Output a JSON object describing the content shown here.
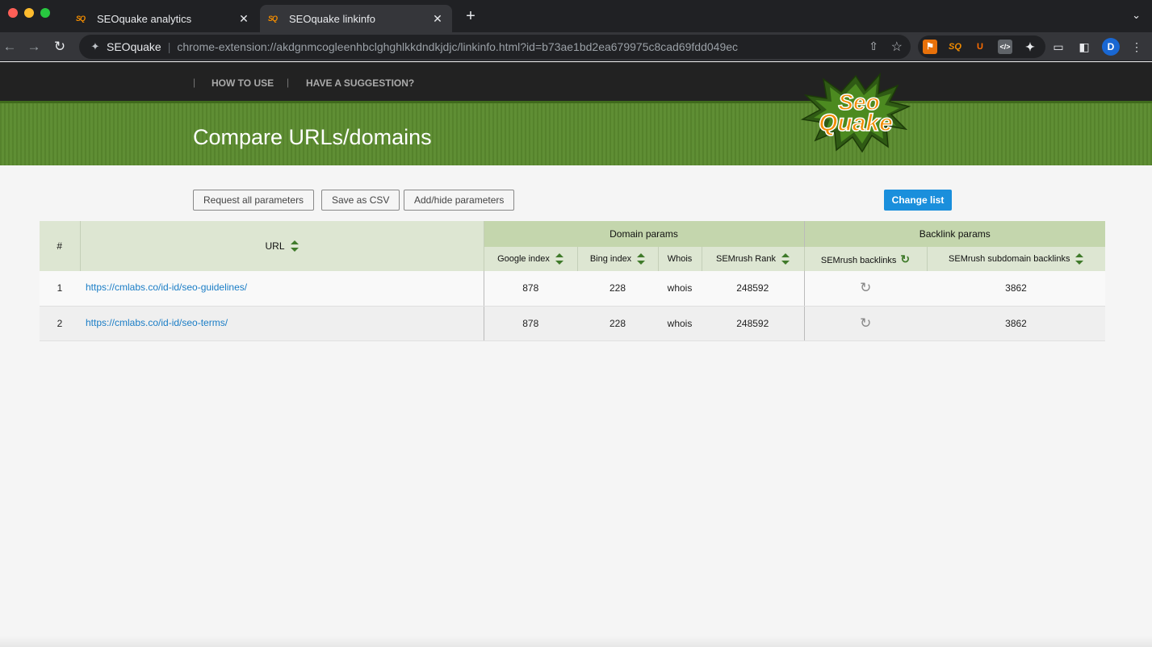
{
  "browser": {
    "tabs": [
      {
        "title": "SEOquake analytics",
        "active": false,
        "favicon": "SQ"
      },
      {
        "title": "SEOquake linkinfo",
        "active": true,
        "favicon": "SQ"
      }
    ],
    "omnibox": {
      "extension_name": "SEOquake",
      "url": "chrome-extension://akdgnmcogleenhbclghghlkkdndkjdjc/linkinfo.html?id=b73ae1bd2ea679975c8cad69fdd049ec"
    },
    "extensions": [
      "SQ",
      "U",
      "</>"
    ],
    "profile_initial": "D"
  },
  "header": {
    "nav": [
      {
        "label": "How to use"
      },
      {
        "label": "Have a suggestion?"
      }
    ]
  },
  "banner": {
    "title": "Compare URLs/domains",
    "logo_top": "Seo",
    "logo_bottom": "Quake"
  },
  "actions": {
    "request_all": "Request all parameters",
    "save_csv": "Save as CSV",
    "add_hide": "Add/hide parameters",
    "change_list": "Change list"
  },
  "table": {
    "col_index": "#",
    "col_url": "URL",
    "group_domain": "Domain params",
    "group_backlink": "Backlink params",
    "domain_cols": [
      "Google index",
      "Bing index",
      "Whois",
      "SEMrush Rank"
    ],
    "backlink_cols": [
      "SEMrush backlinks",
      "SEMrush subdomain backlinks"
    ],
    "rows": [
      {
        "index": "1",
        "url": "https://cmlabs.co/id-id/seo-guidelines/",
        "google_index": "878",
        "bing_index": "228",
        "whois": "whois",
        "semrush_rank": "248592",
        "subdomain_backlinks": "3862"
      },
      {
        "index": "2",
        "url": "https://cmlabs.co/id-id/seo-terms/",
        "google_index": "878",
        "bing_index": "228",
        "whois": "whois",
        "semrush_rank": "248592",
        "subdomain_backlinks": "3862"
      }
    ]
  },
  "colors": {
    "banner_green": "#5a8a2e",
    "primary_blue": "#1a8fdc",
    "link_blue": "#1a7dc6",
    "header_group": "#c4d6ad"
  }
}
